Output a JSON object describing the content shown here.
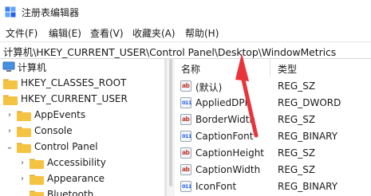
{
  "window": {
    "title": "注册表编辑器",
    "icon": "registry-editor-icon"
  },
  "menu": [
    "文件(F)",
    "编辑(E)",
    "查看(V)",
    "收藏夹(A)",
    "帮助(H)"
  ],
  "address": {
    "path": "计算机\\HKEY_CURRENT_USER\\Control Panel\\Desktop\\WindowMetrics"
  },
  "tree": {
    "items": [
      {
        "label": "计算机",
        "expander": ""
      },
      {
        "label": "HKEY_CLASSES_ROOT",
        "expander": ""
      },
      {
        "label": "HKEY_CURRENT_USER",
        "expander": ""
      },
      {
        "label": "AppEvents",
        "expander": "›"
      },
      {
        "label": "Console",
        "expander": "›"
      },
      {
        "label": "Control Panel",
        "expander": "⌄"
      },
      {
        "label": "Accessibility",
        "expander": "›"
      },
      {
        "label": "Appearance",
        "expander": "›"
      },
      {
        "label": "Bluetooth",
        "expander": ""
      }
    ]
  },
  "list": {
    "headers": {
      "name": "名称",
      "type": "类型"
    },
    "rows": [
      {
        "name": "(默认)",
        "type": "REG_SZ",
        "icon": "ab"
      },
      {
        "name": "AppliedDPI",
        "type": "REG_DWORD",
        "icon": "bin"
      },
      {
        "name": "BorderWidth",
        "type": "REG_SZ",
        "icon": "ab"
      },
      {
        "name": "CaptionFont",
        "type": "REG_BINARY",
        "icon": "bin"
      },
      {
        "name": "CaptionHeight",
        "type": "REG_SZ",
        "icon": "ab"
      },
      {
        "name": "CaptionWidth",
        "type": "REG_SZ",
        "icon": "ab"
      },
      {
        "name": "IconFont",
        "type": "REG_BINARY",
        "icon": "bin"
      }
    ]
  },
  "colors": {
    "folder": "#f5c342",
    "folder_dark": "#e0a526",
    "annotation_arrow": "#e8343a",
    "ab_icon": "#c0392b",
    "binary_icon": "#2563eb"
  }
}
